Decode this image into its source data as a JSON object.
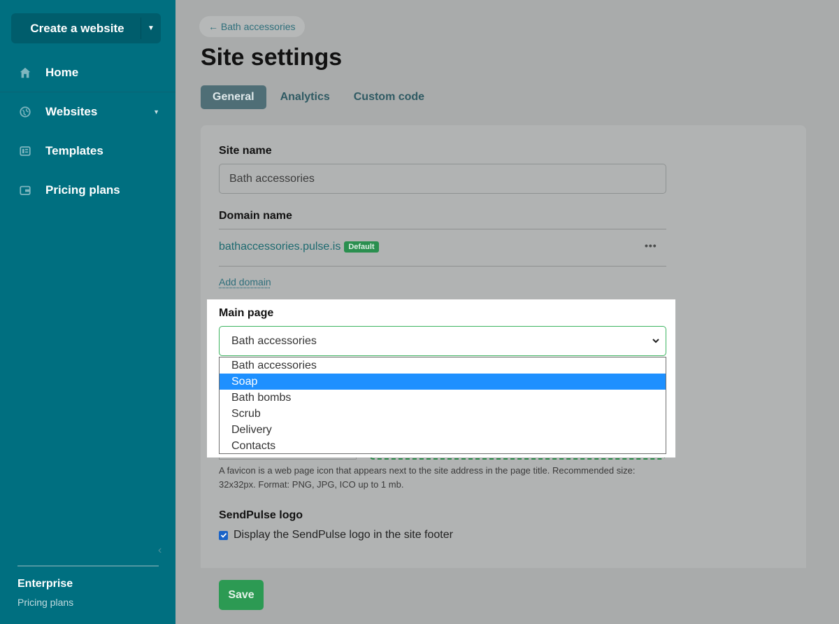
{
  "sidebar": {
    "create_label": "Create a website",
    "items": [
      {
        "label": "Home",
        "icon": "home-icon"
      },
      {
        "label": "Websites",
        "icon": "globe-icon"
      },
      {
        "label": "Templates",
        "icon": "templates-icon"
      },
      {
        "label": "Pricing plans",
        "icon": "wallet-icon"
      }
    ],
    "plan_name": "Enterprise",
    "plan_link": "Pricing plans"
  },
  "header": {
    "back_label": "← Bath accessories",
    "title": "Site settings",
    "tabs": [
      "General",
      "Analytics",
      "Custom code"
    ],
    "active_tab": "General"
  },
  "form": {
    "site_name_label": "Site name",
    "site_name_value": "Bath accessories",
    "domain_label": "Domain name",
    "domain": "bathaccessories.pulse.is",
    "domain_badge": "Default",
    "add_domain": "Add domain",
    "main_page_label": "Main page",
    "main_page_value": "Bath accessories",
    "main_page_options": [
      "Bath accessories",
      "Soap",
      "Bath bombs",
      "Scrub",
      "Delivery",
      "Contacts"
    ],
    "highlighted_option": "Soap",
    "favicon_hint": "A favicon is a web page icon that appears next to the site address in the page title. Recommended size: 32x32px. Format: PNG, JPG, ICO up to 1 mb.",
    "logo_label": "SendPulse logo",
    "logo_checkbox": "Display the SendPulse logo in the site footer",
    "logo_checked": true,
    "save_label": "Save"
  },
  "colors": {
    "sidebar": "#006f80",
    "accent_green": "#2c9a53",
    "option_highlight": "#1e90ff"
  }
}
